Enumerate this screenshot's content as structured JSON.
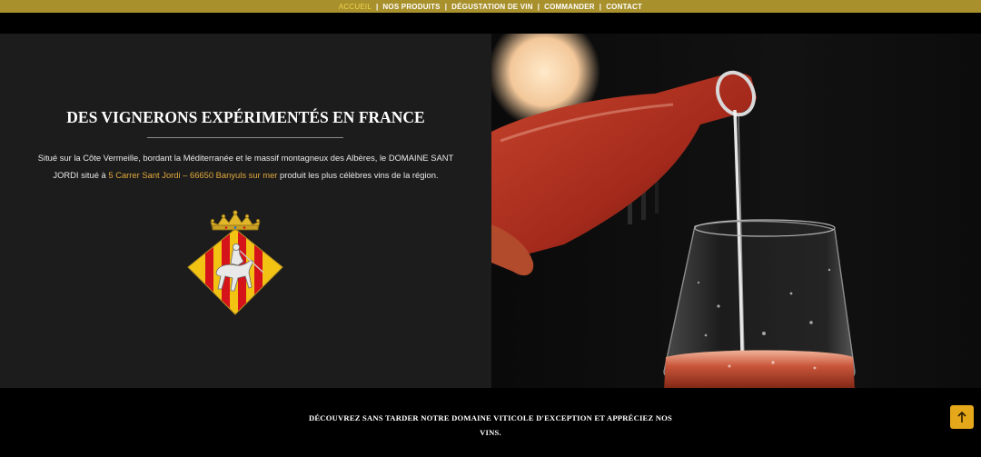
{
  "nav": {
    "items": [
      {
        "label": "ACCUEIL",
        "active": true
      },
      {
        "label": "NOS PRODUITS",
        "active": false
      },
      {
        "label": "DÉGUSTATION DE VIN",
        "active": false
      },
      {
        "label": "COMMANDER",
        "active": false
      },
      {
        "label": "CONTACT",
        "active": false
      }
    ],
    "separator": "|"
  },
  "hero": {
    "title": "DES VIGNERONS EXPÉRIMENTÉS EN FRANCE",
    "intro_part1": "Situé sur la Côte Vermeille, bordant la Méditerranée et le massif montagneux des Albères, le DOMAINE SANT JORDI situé à ",
    "address": "5 Carrer Sant Jordi – 66650 Banyuls sur mer",
    "intro_part2": " produit les plus célèbres vins de la région."
  },
  "tagline": "DÉCOUVREZ SANS TARDER NOTRE DOMAINE VITICOLE D'EXCEPTION ET APPRÉCIEZ NOS VINS.",
  "icons": {
    "coat_of_arms": "coat-of-arms-icon",
    "back_to_top": "arrow-up-icon"
  },
  "colors": {
    "nav_bar": "#a8902c",
    "nav_active": "#f4d54a",
    "panel": "#1c1c1c",
    "address_link": "#e2a93c",
    "back_to_top": "#e4a81a"
  }
}
